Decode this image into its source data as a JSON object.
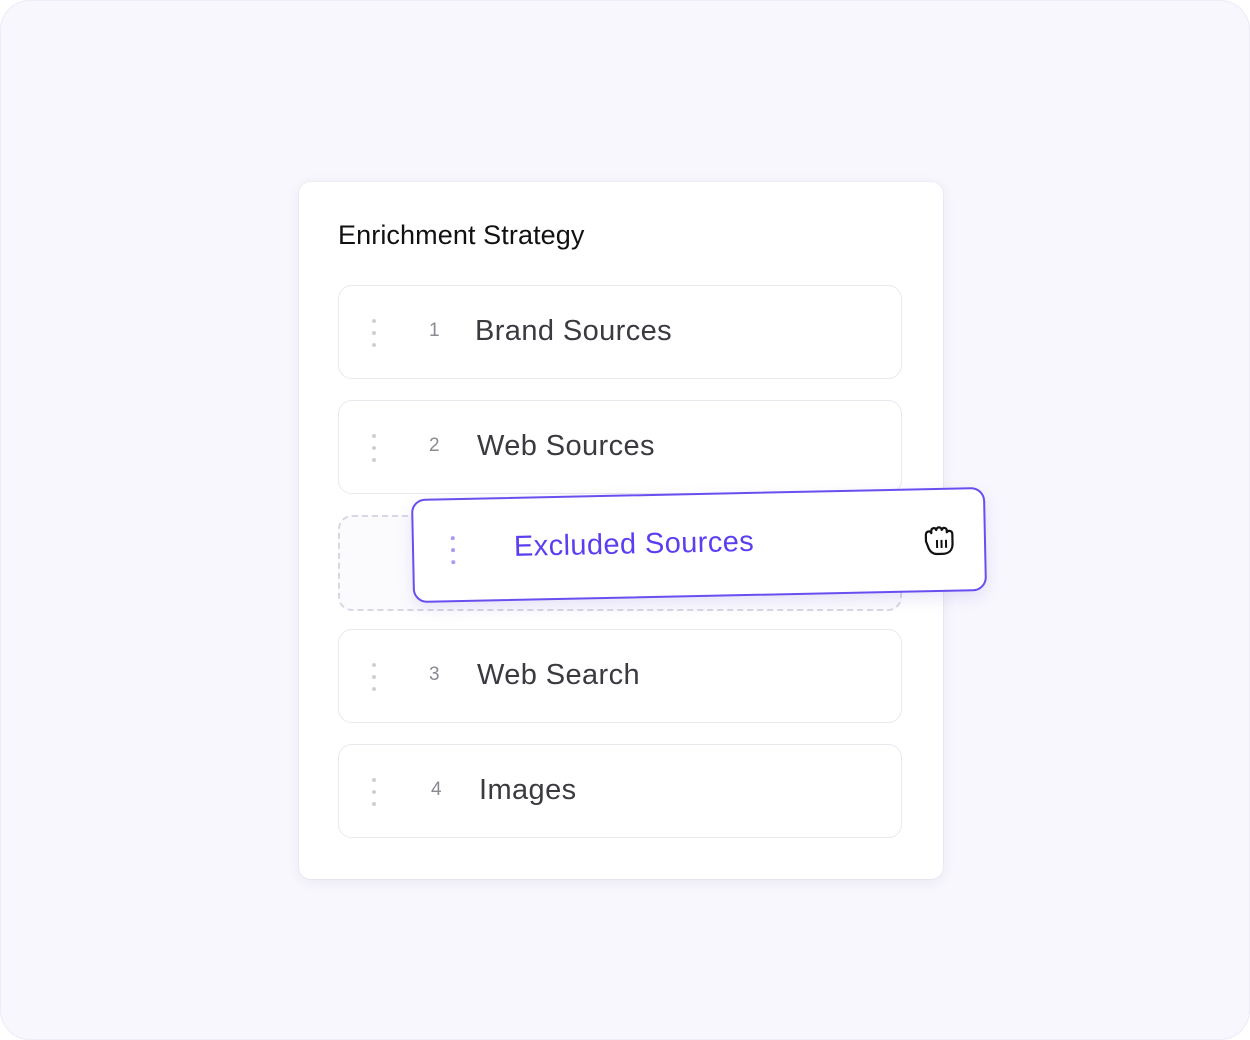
{
  "card": {
    "title": "Enrichment Strategy",
    "items": [
      {
        "number": "1",
        "label": "Brand Sources"
      },
      {
        "number": "2",
        "label": "Web Sources"
      },
      {
        "number": "3",
        "label": "Web Search"
      },
      {
        "number": "4",
        "label": "Images"
      }
    ],
    "dragging": {
      "label": "Excluded Sources",
      "cursor_icon": "grab-hand-icon"
    }
  },
  "colors": {
    "accent": "#5a3ff0",
    "accent_border": "#6a4ef0",
    "text": "#3a3a40",
    "muted": "#8b8a93",
    "background": "#f8f7fd"
  }
}
